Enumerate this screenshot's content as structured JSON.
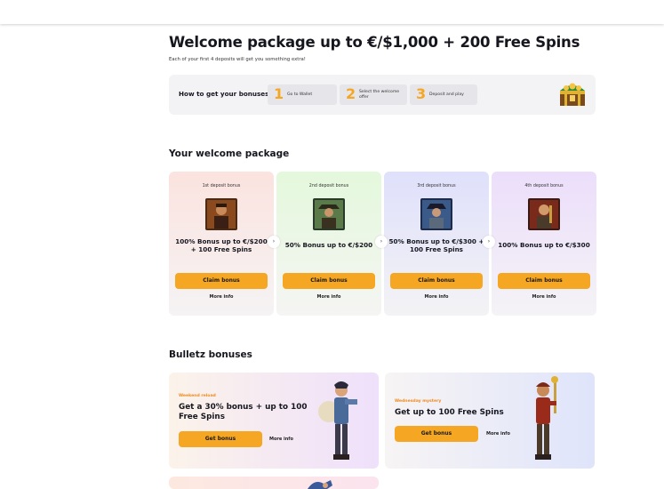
{
  "hero": {
    "title": "Welcome package up to €/$1,000 + 200 Free Spins",
    "subtitle": "Each of your first 4 deposits will get you something extra!"
  },
  "howto": {
    "label": "How to get your bonuses:",
    "steps": [
      {
        "num": "1",
        "text": "Go to Wallet"
      },
      {
        "num": "2",
        "text": "Select the welcome offer"
      },
      {
        "num": "3",
        "text": "Deposit and play"
      }
    ]
  },
  "welcome": {
    "title": "Your welcome package",
    "cards": [
      {
        "label": "1st deposit bonus",
        "text": "100% Bonus up to €/$200 + 100 Free Spins",
        "button": "Claim bonus",
        "more": "More info",
        "color": "#fbe3df"
      },
      {
        "label": "2nd deposit bonus",
        "text": "50% Bonus up to €/$200",
        "button": "Claim bonus",
        "more": "More info",
        "color": "#e4f8dc"
      },
      {
        "label": "3rd deposit bonus",
        "text": "50% Bonus up to €/$300 + 100 Free Spins",
        "button": "Claim bonus",
        "more": "More info",
        "color": "#dfe0fb"
      },
      {
        "label": "4th deposit bonus",
        "text": "100% Bonus up to €/$300",
        "button": "Claim bonus",
        "more": "More info",
        "color": "#ecdefb"
      }
    ],
    "arrow": "›"
  },
  "bulletz": {
    "title": "Bulletz bonuses",
    "promos": [
      {
        "tag": "Weekend reload",
        "title": "Get a 30% bonus + up to 100 Free Spins",
        "button": "Get bonus",
        "more": "More info"
      },
      {
        "tag": "Wednesday mystery",
        "title": "Get up to 100 Free Spins",
        "button": "Get bonus",
        "more": "More info"
      }
    ]
  },
  "colors": {
    "accent": "#f5a623",
    "step_number": "#f5a623",
    "promo_tag": "#f08a1c"
  }
}
